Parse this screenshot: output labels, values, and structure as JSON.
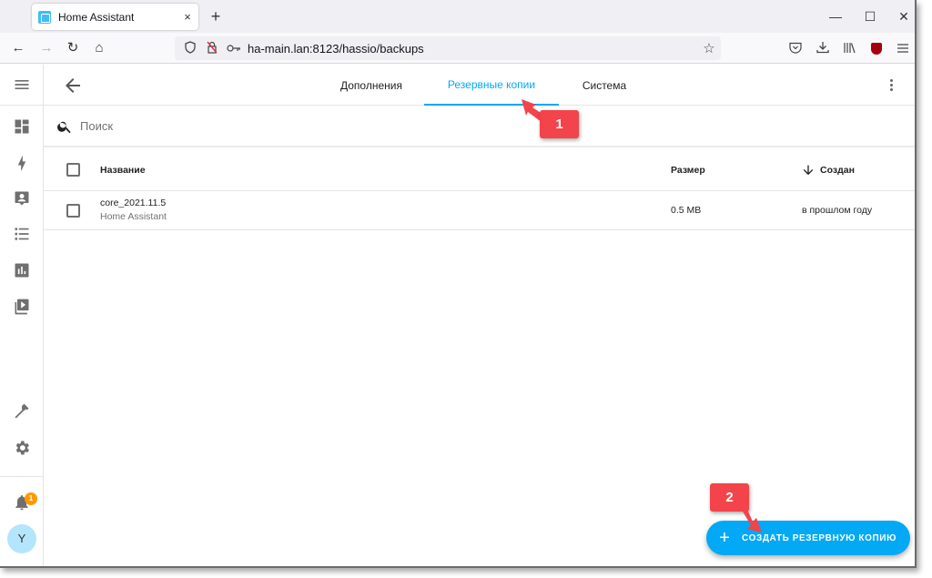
{
  "browser": {
    "tab_title": "Home Assistant",
    "tab_close": "×",
    "new_tab": "+",
    "window_controls": {
      "minimize": "—",
      "maximize": "☐",
      "close": "✕"
    },
    "nav": {
      "back": "←",
      "forward": "→",
      "reload": "↻",
      "home": "⌂"
    },
    "url": "ha-main.lan:8123/hassio/backups",
    "url_icons": [
      "shield-icon",
      "lock-off-icon",
      "key-icon"
    ],
    "toolbar_icons": [
      "pocket-icon",
      "download-icon",
      "library-icon",
      "ublock-icon",
      "menu-icon"
    ]
  },
  "sidebar": {
    "items": [
      {
        "name": "overview",
        "icon": "dashboard-icon"
      },
      {
        "name": "energy",
        "icon": "lightning-icon"
      },
      {
        "name": "map",
        "icon": "account-box-icon"
      },
      {
        "name": "logbook",
        "icon": "list-icon"
      },
      {
        "name": "history",
        "icon": "chart-box-icon"
      },
      {
        "name": "media",
        "icon": "play-box-multiple-icon"
      }
    ],
    "bottom_items": [
      {
        "name": "developer-tools",
        "icon": "hammer-icon"
      },
      {
        "name": "settings",
        "icon": "gear-icon"
      }
    ],
    "notifications_count": "1",
    "avatar_initial": "Y"
  },
  "header": {
    "tabs": [
      {
        "label": "Дополнения",
        "active": false
      },
      {
        "label": "Резервные копии",
        "active": true
      },
      {
        "label": "Система",
        "active": false
      }
    ]
  },
  "search": {
    "placeholder": "Поиск",
    "value": ""
  },
  "table": {
    "columns": [
      "Название",
      "Размер",
      "Создан"
    ],
    "sort_column": "Создан",
    "sort_direction": "descending",
    "rows": [
      {
        "name": "core_2021.11.5",
        "subtitle": "Home Assistant",
        "size": "0.5 MB",
        "created": "в прошлом году",
        "checked": false
      }
    ]
  },
  "fab": {
    "label": "СОЗДАТЬ РЕЗЕРВНУЮ КОПИЮ",
    "icon": "+"
  },
  "annotations": [
    {
      "number": "1",
      "color": "#f2444a"
    },
    {
      "number": "2",
      "color": "#f2444a"
    }
  ],
  "colors": {
    "accent": "#03a9f4",
    "badge": "#ff9800",
    "avatar_bg": "#b3e5fc",
    "annotation": "#f2444a"
  }
}
